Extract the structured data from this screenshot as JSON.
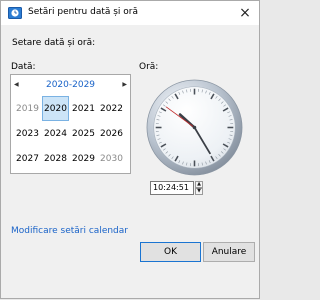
{
  "window": {
    "title": "Setări pentru dată și oră",
    "close_glyph": "×",
    "icon": "clock-app-icon"
  },
  "heading": "Setare dată și oră:",
  "date_section": {
    "label": "Dată:",
    "calendar": {
      "prev_glyph": "◀",
      "next_glyph": "▶",
      "decade": "2020-2029",
      "years": [
        {
          "label": "2019",
          "state": "dim"
        },
        {
          "label": "2020",
          "state": "selected"
        },
        {
          "label": "2021",
          "state": "normal"
        },
        {
          "label": "2022",
          "state": "normal"
        },
        {
          "label": "2023",
          "state": "normal"
        },
        {
          "label": "2024",
          "state": "normal"
        },
        {
          "label": "2025",
          "state": "normal"
        },
        {
          "label": "2026",
          "state": "normal"
        },
        {
          "label": "2027",
          "state": "normal"
        },
        {
          "label": "2028",
          "state": "normal"
        },
        {
          "label": "2029",
          "state": "normal"
        },
        {
          "label": "2030",
          "state": "dim"
        }
      ]
    }
  },
  "time_section": {
    "label": "Oră:",
    "time_value": "10:24:51",
    "clock": {
      "hours": 10,
      "minutes": 24,
      "seconds": 51
    },
    "spin_up_glyph": "▲",
    "spin_down_glyph": "▼"
  },
  "footer": {
    "calendar_link": "Modificare setări calendar",
    "ok_label": "OK",
    "cancel_label": "Anulare"
  },
  "colors": {
    "accent": "#1a63c8",
    "selected_bg": "#cce4f7",
    "dim_text": "#8a8a8a"
  }
}
